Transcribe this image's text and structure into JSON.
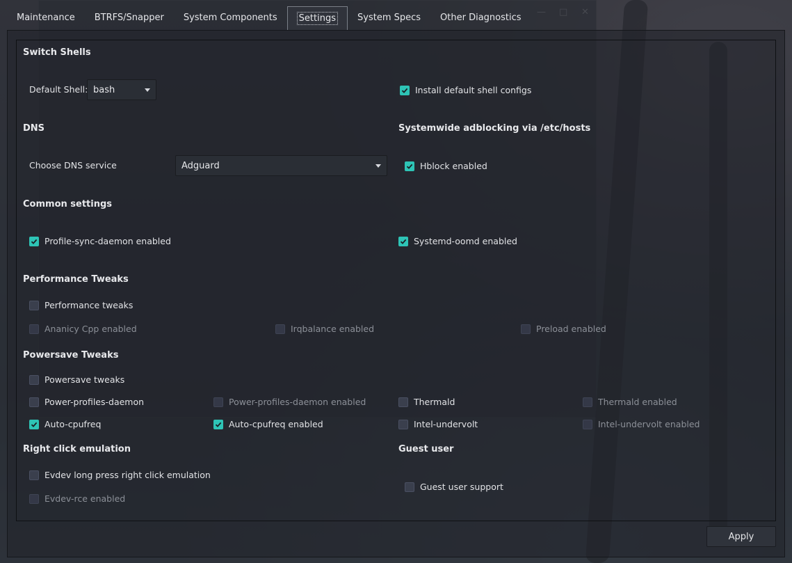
{
  "tabs": [
    {
      "label": "Maintenance"
    },
    {
      "label": "BTRFS/Snapper"
    },
    {
      "label": "System Components"
    },
    {
      "label": "Settings",
      "active": true
    },
    {
      "label": "System Specs"
    },
    {
      "label": "Other Diagnostics"
    }
  ],
  "switch_shells": {
    "title": "Switch Shells",
    "default_shell_label": "Default Shell:",
    "default_shell_value": "bash",
    "install_configs": {
      "label": "Install default shell configs",
      "checked": true
    }
  },
  "dns": {
    "title": "DNS",
    "choose_label": "Choose DNS service",
    "service_value": "Adguard"
  },
  "adblock": {
    "title": "Systemwide adblocking via /etc/hosts",
    "hblock": {
      "label": "Hblock enabled",
      "checked": true
    }
  },
  "common": {
    "title": "Common settings",
    "psd": {
      "label": "Profile-sync-daemon enabled",
      "checked": true
    },
    "oomd": {
      "label": "Systemd-oomd enabled",
      "checked": true
    }
  },
  "performance": {
    "title": "Performance Tweaks",
    "tweaks": {
      "label": "Performance tweaks",
      "checked": false
    },
    "ananicy": {
      "label": "Ananicy Cpp enabled",
      "checked": false
    },
    "irqbalance": {
      "label": "Irqbalance enabled",
      "checked": false
    },
    "preload": {
      "label": "Preload enabled",
      "checked": false
    }
  },
  "powersave": {
    "title": "Powersave Tweaks",
    "tweaks": {
      "label": "Powersave tweaks",
      "checked": false
    },
    "ppd": {
      "label": "Power-profiles-daemon",
      "checked": false
    },
    "ppd_enabled": {
      "label": "Power-profiles-daemon enabled",
      "checked": false
    },
    "thermald": {
      "label": "Thermald",
      "checked": false
    },
    "thermald_enabled": {
      "label": "Thermald enabled",
      "checked": false
    },
    "autocpufreq": {
      "label": "Auto-cpufreq",
      "checked": true
    },
    "autocpufreq_enabled": {
      "label": "Auto-cpufreq enabled",
      "checked": true
    },
    "undervolt": {
      "label": "Intel-undervolt",
      "checked": false
    },
    "undervolt_enabled": {
      "label": "Intel-undervolt enabled",
      "checked": false
    }
  },
  "right_click": {
    "title": "Right click emulation",
    "evdev": {
      "label": "Evdev long press right click emulation",
      "checked": false
    },
    "evdev_rce": {
      "label": "Evdev-rce enabled",
      "checked": false
    }
  },
  "guest": {
    "title": "Guest user",
    "support": {
      "label": "Guest user support",
      "checked": false
    }
  },
  "apply_label": "Apply",
  "colors": {
    "accent": "#2ec4b6",
    "panel": "#2a2e35"
  }
}
